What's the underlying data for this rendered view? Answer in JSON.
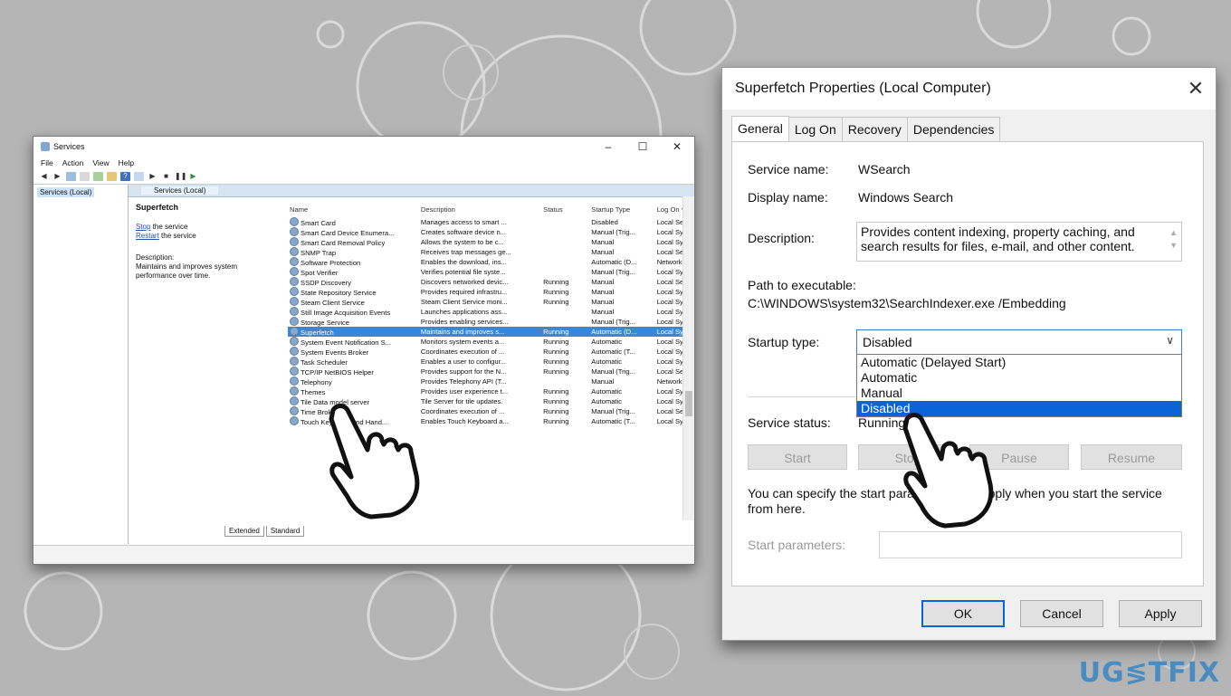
{
  "services_window": {
    "title": "Services",
    "controls": {
      "minimize": "–",
      "maximize": "☐",
      "close": "✕"
    },
    "menu": [
      "File",
      "Action",
      "View",
      "Help"
    ],
    "tree_item": "Services (Local)",
    "header_label": "Services (Local)",
    "selected_service": {
      "name": "Superfetch",
      "stop_link": "Stop",
      "stop_rest": "the service",
      "restart_link": "Restart",
      "restart_rest": "the service",
      "description_label": "Description:",
      "description": "Maintains and improves system performance over time."
    },
    "columns": [
      "Name",
      "Description",
      "Status",
      "Startup Type",
      "Log On ^"
    ],
    "rows": [
      [
        "Smart Card",
        "Manages access to smart ...",
        "",
        "Disabled",
        "Local Se"
      ],
      [
        "Smart Card Device Enumera...",
        "Creates software device n...",
        "",
        "Manual (Trig...",
        "Local Sy"
      ],
      [
        "Smart Card Removal Policy",
        "Allows the system to be c...",
        "",
        "Manual",
        "Local Sy"
      ],
      [
        "SNMP Trap",
        "Receives trap messages ge...",
        "",
        "Manual",
        "Local Se"
      ],
      [
        "Software Protection",
        "Enables the download, ins...",
        "",
        "Automatic (D...",
        "Network"
      ],
      [
        "Spot Verifier",
        "Verifies potential file syste...",
        "",
        "Manual (Trig...",
        "Local Sy"
      ],
      [
        "SSDP Discovery",
        "Discovers networked devic...",
        "Running",
        "Manual",
        "Local Se"
      ],
      [
        "State Repository Service",
        "Provides required infrastru...",
        "Running",
        "Manual",
        "Local Sy"
      ],
      [
        "Steam Client Service",
        "Steam Client Service moni...",
        "Running",
        "Manual",
        "Local Sy"
      ],
      [
        "Still Image Acquisition Events",
        "Launches applications ass...",
        "",
        "Manual",
        "Local Sy"
      ],
      [
        "Storage Service",
        "Provides enabling services...",
        "",
        "Manual (Trig...",
        "Local Sy"
      ],
      [
        "Superfetch",
        "Maintains and improves s...",
        "Running",
        "Automatic (D...",
        "Local Sy"
      ],
      [
        "System Event Notification S...",
        "Monitors system events a...",
        "Running",
        "Automatic",
        "Local Sy"
      ],
      [
        "System Events Broker",
        "Coordinates execution of ...",
        "Running",
        "Automatic (T...",
        "Local Sy"
      ],
      [
        "Task Scheduler",
        "Enables a user to configur...",
        "Running",
        "Automatic",
        "Local Sy"
      ],
      [
        "TCP/IP NetBIOS Helper",
        "Provides support for the N...",
        "Running",
        "Manual (Trig...",
        "Local Se"
      ],
      [
        "Telephony",
        "Provides Telephony API (T...",
        "",
        "Manual",
        "Network"
      ],
      [
        "Themes",
        "Provides user experience t...",
        "Running",
        "Automatic",
        "Local Sy"
      ],
      [
        "Tile Data model server",
        "Tile Server for tile updates.",
        "Running",
        "Automatic",
        "Local Sy"
      ],
      [
        "Time Broker",
        "Coordinates execution of ...",
        "Running",
        "Manual (Trig...",
        "Local Se"
      ],
      [
        "Touch Keyboard and Hand...",
        "Enables Touch Keyboard a...",
        "Running",
        "Automatic (T...",
        "Local Sy"
      ]
    ],
    "selected_row_index": 11,
    "bottom_tabs": [
      "Extended",
      "Standard"
    ]
  },
  "properties_dialog": {
    "title": "Superfetch Properties (Local Computer)",
    "close": "✕",
    "tabs": [
      "General",
      "Log On",
      "Recovery",
      "Dependencies"
    ],
    "service_name_label": "Service name:",
    "service_name": "WSearch",
    "display_name_label": "Display name:",
    "display_name": "Windows Search",
    "description_label": "Description:",
    "description": "Provides content indexing, property caching, and search results for files, e-mail, and other content.",
    "path_label": "Path to executable:",
    "path": "C:\\WINDOWS\\system32\\SearchIndexer.exe /Embedding",
    "startup_type_label": "Startup type:",
    "startup_type_value": "Disabled",
    "startup_options": [
      "Automatic (Delayed Start)",
      "Automatic",
      "Manual",
      "Disabled"
    ],
    "highlighted_option_index": 3,
    "service_status_label": "Service status:",
    "service_status": "Running",
    "buttons": {
      "start": "Start",
      "stop": "Stop",
      "pause": "Pause",
      "resume": "Resume"
    },
    "hint": "You can specify the start parameters that apply when you start the service from here.",
    "start_params_label": "Start parameters:",
    "ok": "OK",
    "cancel": "Cancel",
    "apply": "Apply"
  },
  "watermark": "UG≶TFIX"
}
